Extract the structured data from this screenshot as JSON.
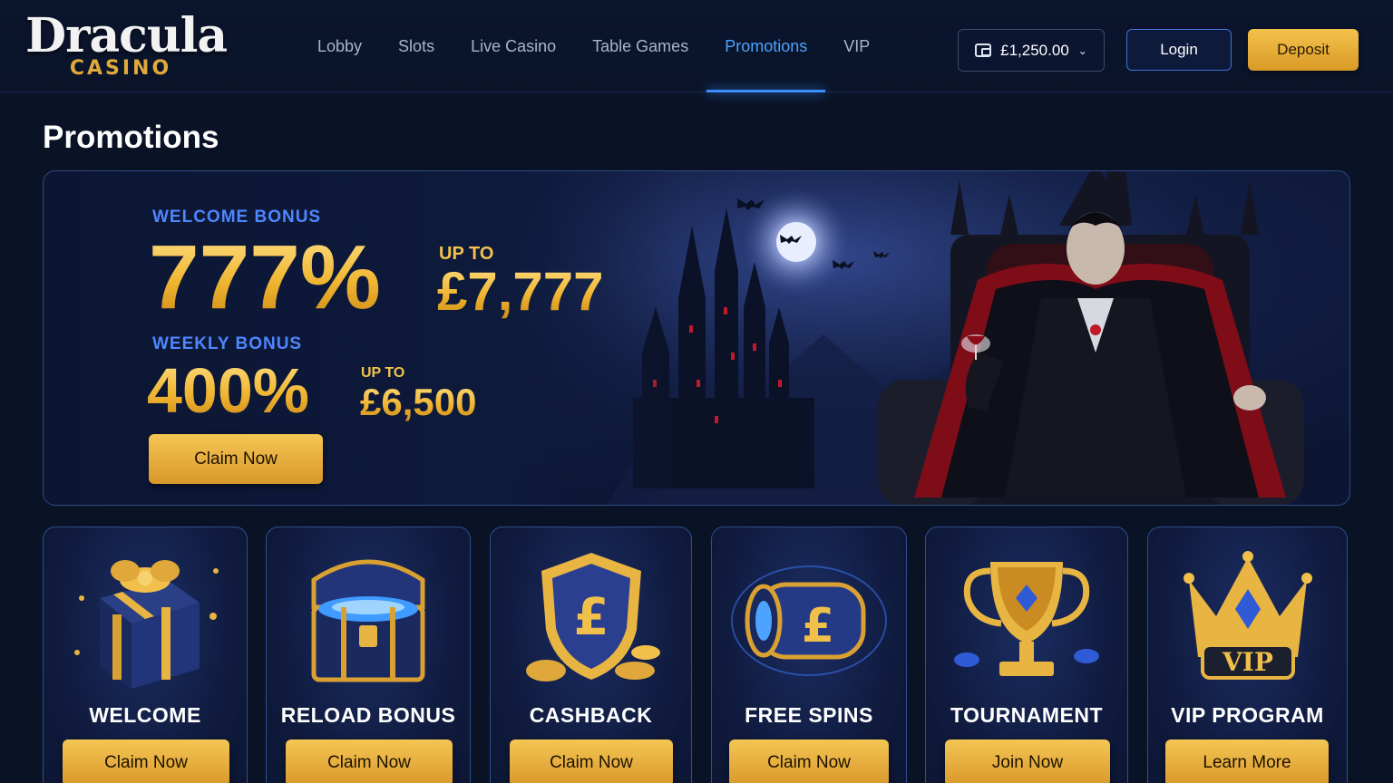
{
  "brand": {
    "name": "Dracula",
    "sub": "CASINO"
  },
  "nav": [
    {
      "label": "Lobby"
    },
    {
      "label": "Slots"
    },
    {
      "label": "Live Casino"
    },
    {
      "label": "Table Games"
    },
    {
      "label": "Promotions",
      "active": true
    },
    {
      "label": "VIP"
    }
  ],
  "header": {
    "balance": "£1,250.00",
    "login_label": "Login",
    "deposit_label": "Deposit"
  },
  "page": {
    "title": "Promotions"
  },
  "hero": {
    "welcome_label": "WELCOME BONUS",
    "welcome_pct": "777%",
    "welcome_upto": "UP TO",
    "welcome_amount": "£7,777",
    "weekly_label": "WEEKLY BONUS",
    "weekly_pct": "400%",
    "weekly_upto": "UP TO",
    "weekly_amount": "£6,500",
    "claim_label": "Claim Now"
  },
  "cards": [
    {
      "title": "WELCOME",
      "button": "Claim Now",
      "icon": "gift-box-icon"
    },
    {
      "title": "RELOAD BONUS",
      "button": "Claim Now",
      "icon": "treasure-chest-icon"
    },
    {
      "title": "CASHBACK",
      "button": "Claim Now",
      "icon": "pound-shield-icon"
    },
    {
      "title": "FREE SPINS",
      "button": "Claim Now",
      "icon": "slot-reel-icon"
    },
    {
      "title": "TOURNAMENT",
      "button": "Join Now",
      "icon": "trophy-icon"
    },
    {
      "title": "VIP PROGRAM",
      "button": "Learn More",
      "icon": "crown-icon",
      "icon_text": "VIP"
    }
  ],
  "colors": {
    "accent_blue": "#3b8eff",
    "gold": "#f4c24d",
    "background": "#0a1226"
  }
}
